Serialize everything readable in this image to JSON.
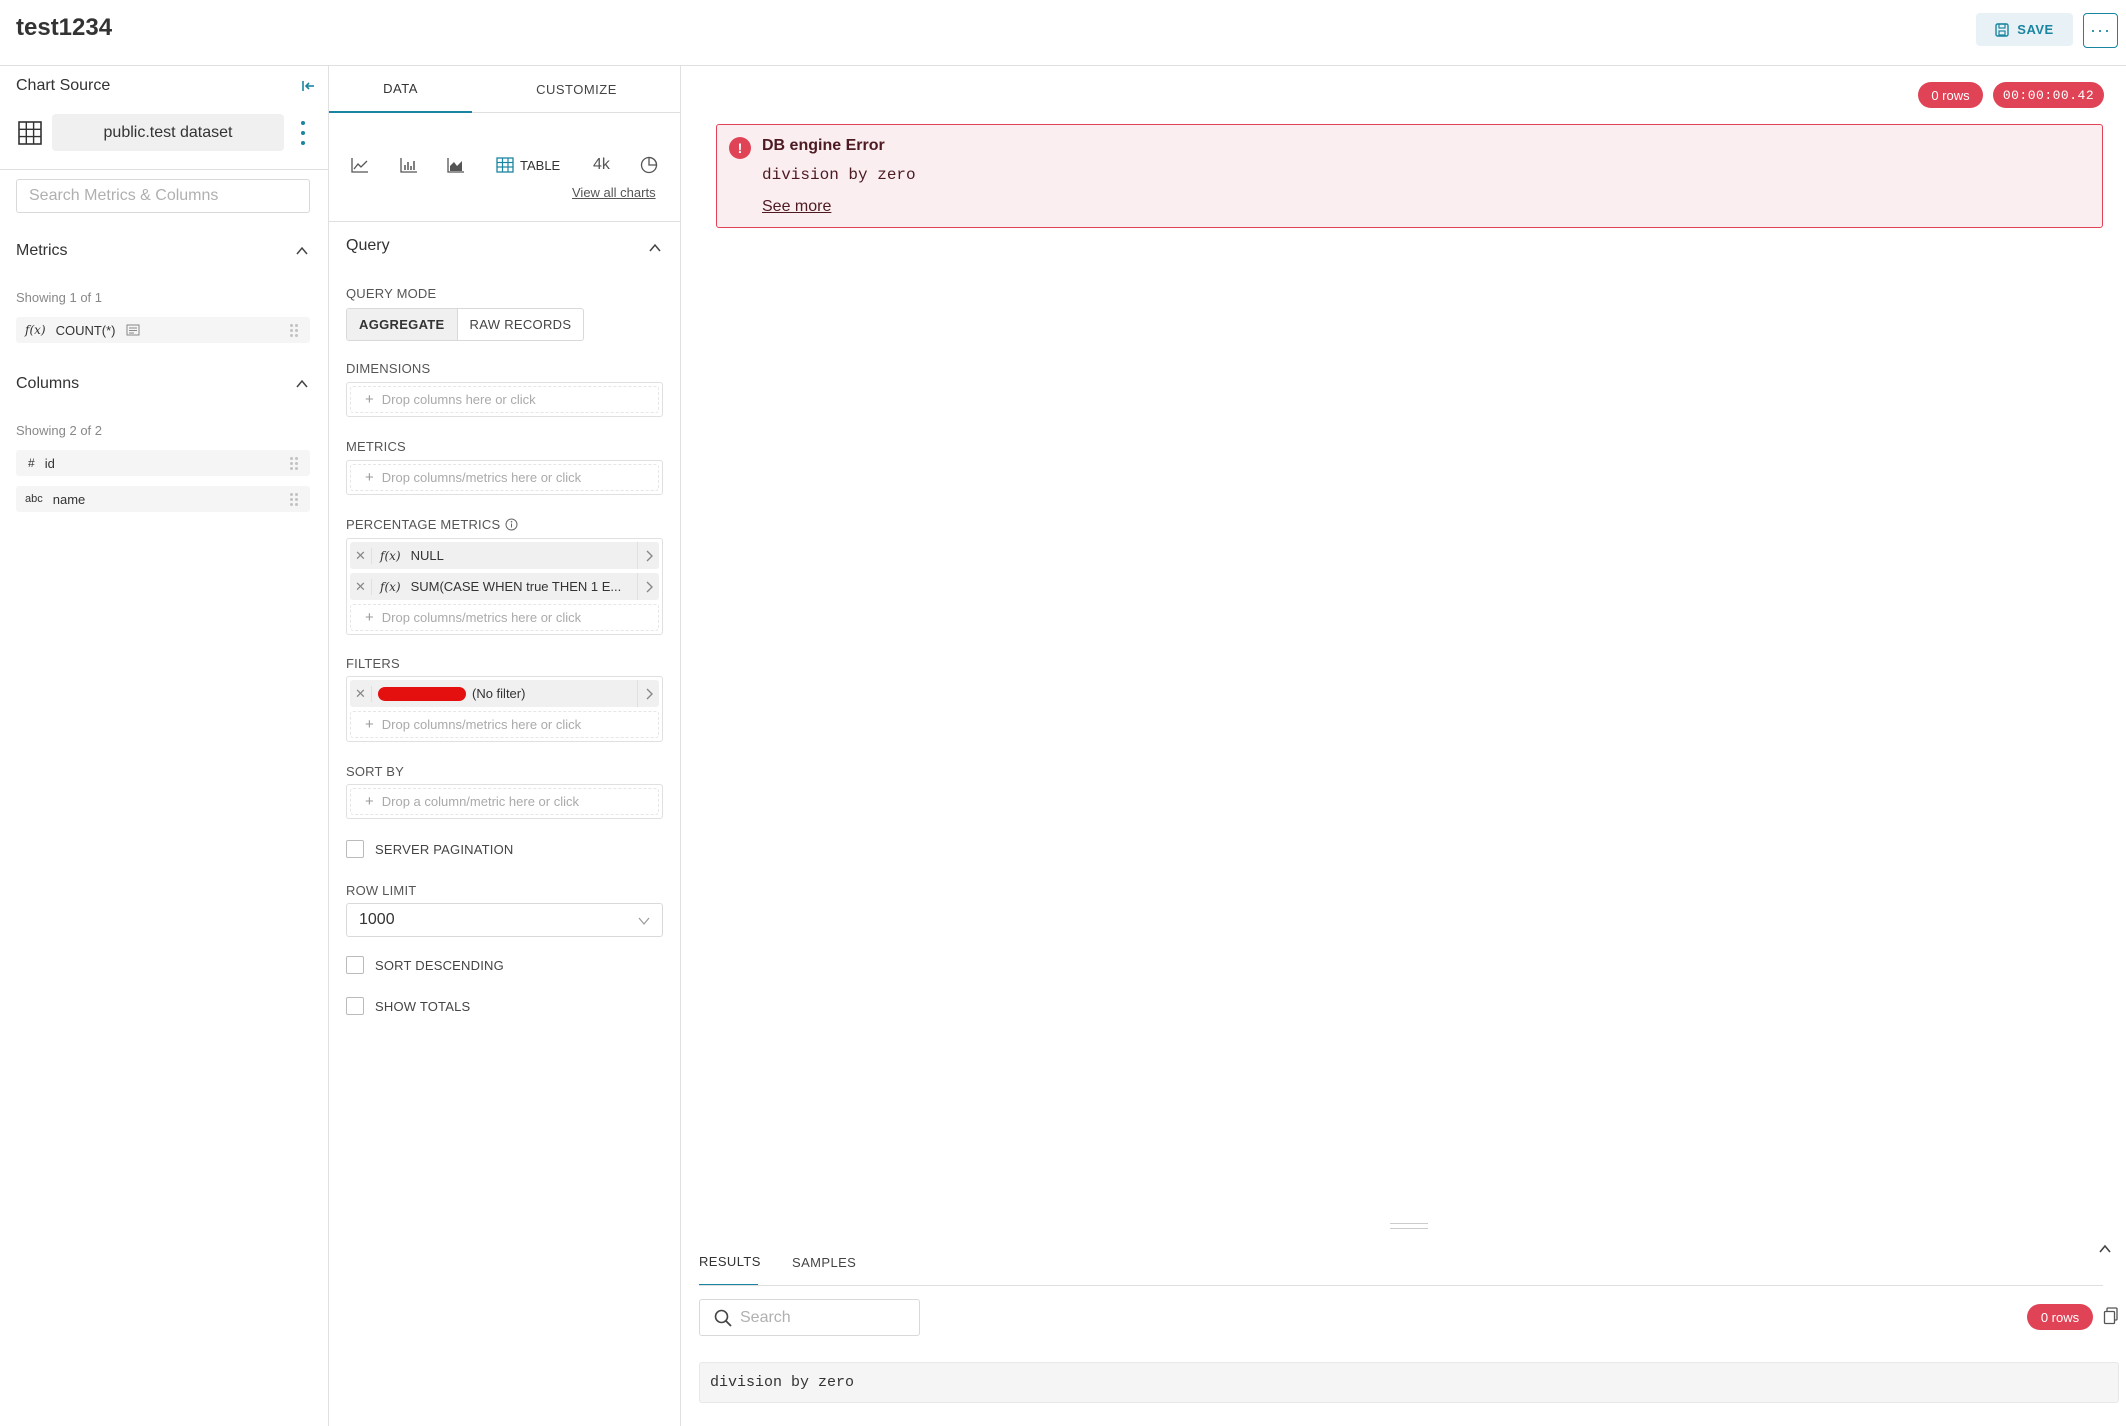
{
  "header": {
    "title": "test1234",
    "save_label": "SAVE",
    "more_label": "···"
  },
  "left": {
    "chart_source_title": "Chart Source",
    "dataset_name": "public.test dataset",
    "search_placeholder": "Search Metrics & Columns",
    "metrics": {
      "title": "Metrics",
      "showing": "Showing 1 of 1",
      "items": [
        {
          "type": "f(x)",
          "name": "COUNT(*)"
        }
      ]
    },
    "columns": {
      "title": "Columns",
      "showing": "Showing 2 of 2",
      "items": [
        {
          "type": "#",
          "name": "id"
        },
        {
          "type": "abc",
          "name": "name"
        }
      ]
    }
  },
  "mid": {
    "tabs": [
      "DATA",
      "CUSTOMIZE"
    ],
    "viz": {
      "table_label": "TABLE",
      "bignum_label": "4k",
      "view_all": "View all charts"
    },
    "query_title": "Query",
    "query_mode_label": "QUERY MODE",
    "query_modes": [
      "AGGREGATE",
      "RAW RECORDS"
    ],
    "dimensions_label": "DIMENSIONS",
    "dimensions_placeholder": "Drop columns here or click",
    "metrics_label": "METRICS",
    "metrics_placeholder": "Drop columns/metrics here or click",
    "percentage_metrics_label": "PERCENTAGE METRICS",
    "percentage_metrics": [
      {
        "fx": "f(x)",
        "label": "NULL"
      },
      {
        "fx": "f(x)",
        "label": "SUM(CASE WHEN true THEN 1 E..."
      }
    ],
    "percentage_placeholder": "Drop columns/metrics here or click",
    "filters_label": "FILTERS",
    "filter_chip_suffix": "(No filter)",
    "filters_placeholder": "Drop columns/metrics here or click",
    "sort_by_label": "SORT BY",
    "sort_by_placeholder": "Drop a column/metric here or click",
    "server_pagination_label": "SERVER PAGINATION",
    "row_limit_label": "ROW LIMIT",
    "row_limit_value": "1000",
    "sort_descending_label": "SORT DESCENDING",
    "show_totals_label": "SHOW TOTALS"
  },
  "right": {
    "rows_badge": "0 rows",
    "time_badge": "00:00:00.42",
    "error_title": "DB engine Error",
    "error_message": "division by zero",
    "see_more": "See more",
    "results_tabs": [
      "RESULTS",
      "SAMPLES"
    ],
    "search_placeholder": "Search",
    "results_rows_badge": "0 rows",
    "results_message": "division by zero"
  },
  "colors": {
    "accent": "#1a85a0",
    "danger": "#e04355"
  }
}
